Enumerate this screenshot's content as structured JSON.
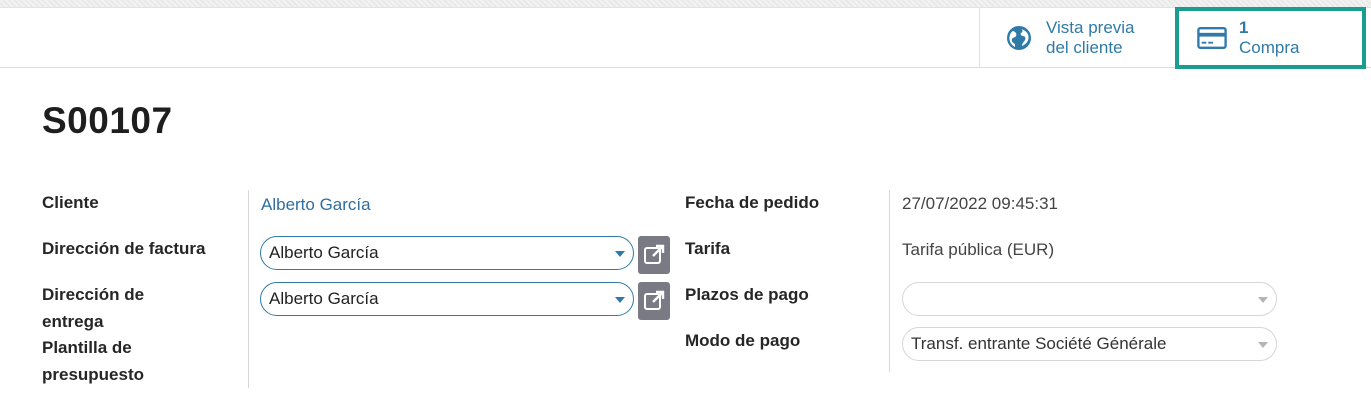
{
  "smart_buttons": {
    "preview": {
      "line1": "Vista previa",
      "line2": "del cliente",
      "icon": "globe-icon"
    },
    "purchase": {
      "count": "1",
      "label": "Compra",
      "icon": "credit-card-icon"
    }
  },
  "record": {
    "name": "S00107"
  },
  "left_fields": {
    "customer": {
      "label": "Cliente",
      "value": "Alberto García"
    },
    "invoice_address": {
      "label": "Dirección de factura",
      "value": "Alberto García"
    },
    "delivery_address": {
      "label_line1": "Dirección de",
      "label_line2": "entrega",
      "value": "Alberto García"
    },
    "quotation_template": {
      "label_line1": "Plantilla de",
      "label_line2": "presupuesto",
      "value": ""
    }
  },
  "right_fields": {
    "order_date": {
      "label": "Fecha de pedido",
      "value": "27/07/2022 09:45:31"
    },
    "pricelist": {
      "label": "Tarifa",
      "value": "Tarifa pública (EUR)"
    },
    "payment_terms": {
      "label": "Plazos de pago",
      "value": ""
    },
    "payment_mode": {
      "label": "Modo de pago",
      "value": "Transf. entrante Société Générale"
    }
  },
  "colors": {
    "accent": "#2f7aa7",
    "highlight": "#1a9c91",
    "external_button": "#7a7a85"
  }
}
